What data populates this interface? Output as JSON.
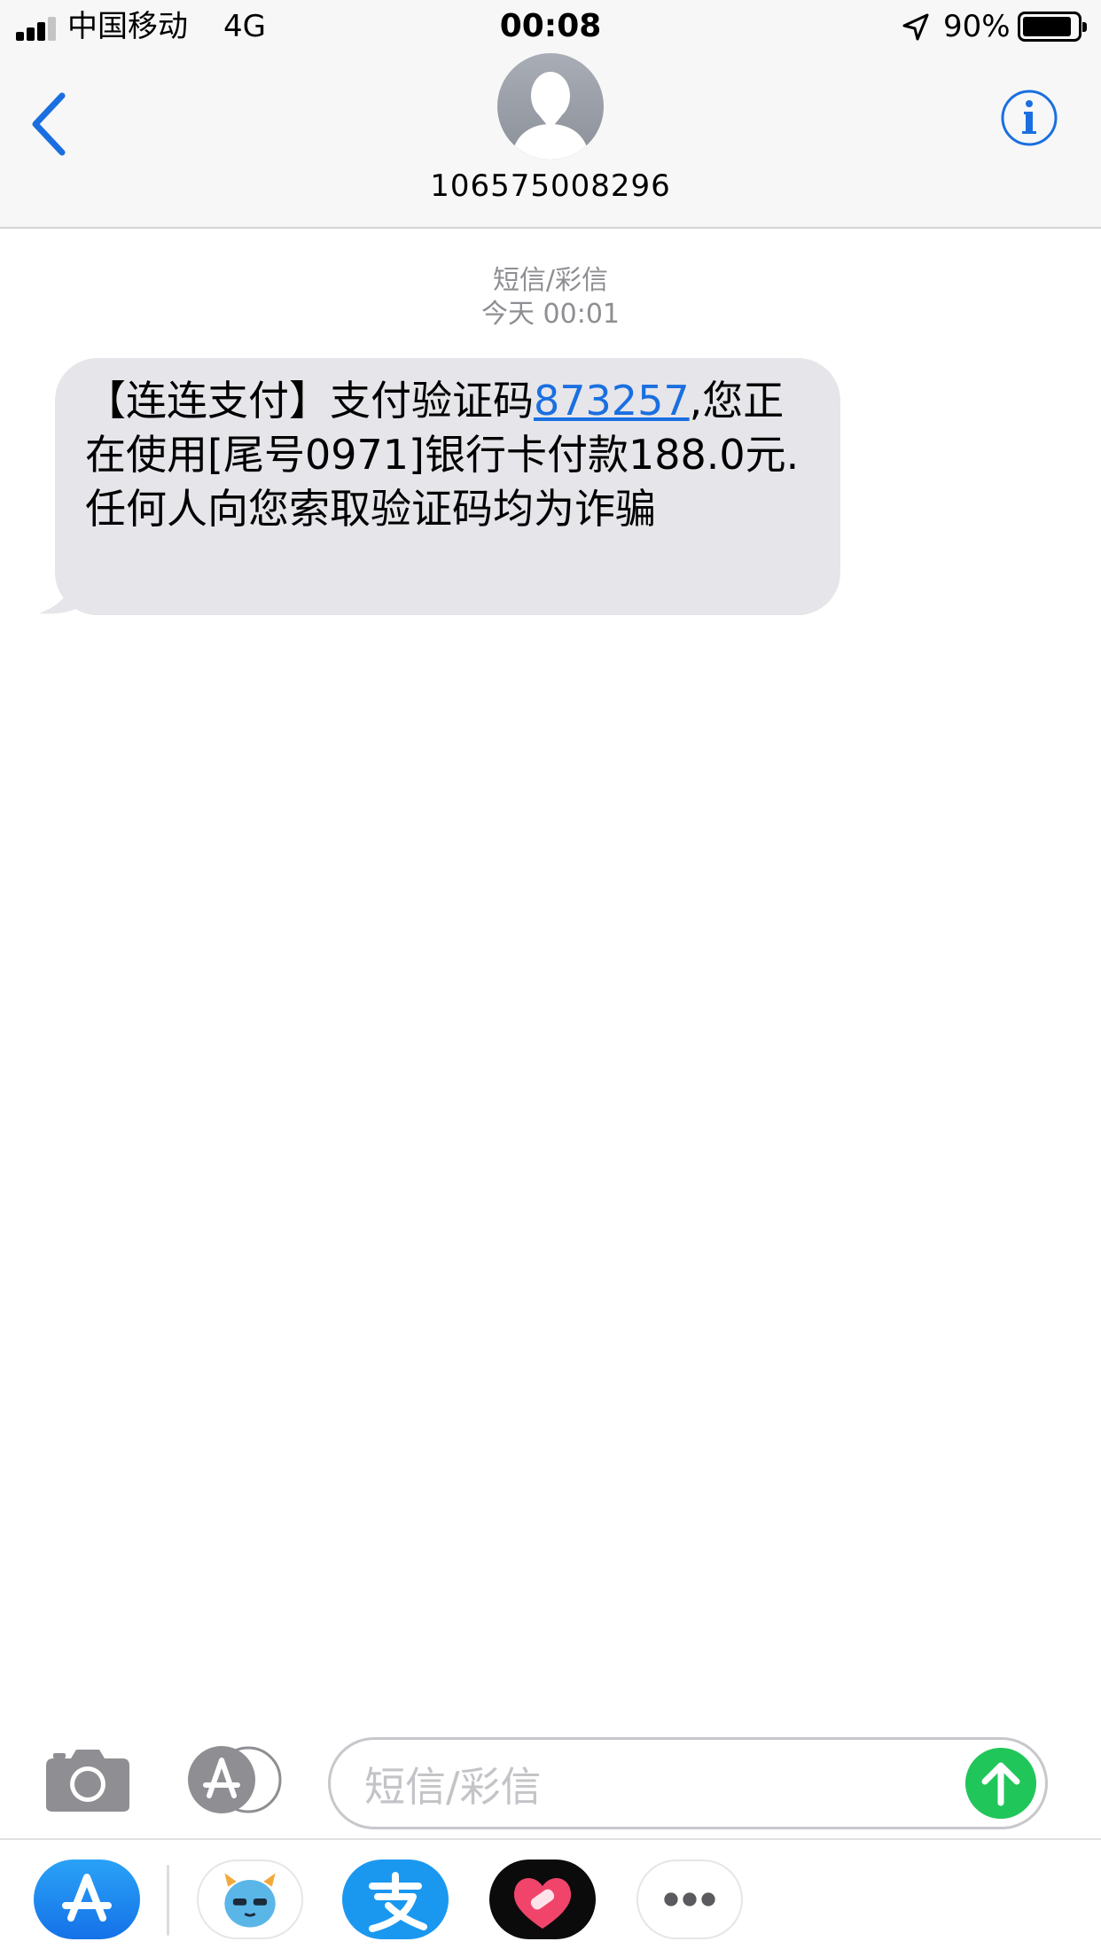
{
  "status_bar": {
    "carrier": "中国移动",
    "network": "4G",
    "time": "00:08",
    "battery_percent": "90%",
    "battery_level": 0.9,
    "icons": [
      "signal-icon",
      "location-arrow-icon",
      "battery-icon"
    ]
  },
  "header": {
    "contact": "106575008296",
    "icons": [
      "back-chevron-icon",
      "contact-avatar-icon",
      "info-icon"
    ],
    "accent_color": "#1a6fe0"
  },
  "conversation": {
    "type_label": "短信/彩信",
    "timestamp": "今天 00:01",
    "message": {
      "prefix": "【连连支付】支付验证码",
      "code": "873257",
      "suffix": ",您正在使用[尾号0971]银行卡付款188.0元.任何人向您索取验证码均为诈骗",
      "bubble_color": "#e5e5ea"
    }
  },
  "compose": {
    "placeholder": "短信/彩信",
    "icons": [
      "camera-icon",
      "app-store-icon",
      "send-arrow-icon"
    ],
    "send_color": "#21c65a"
  },
  "app_drawer": {
    "apps": [
      "app-store-icon",
      "monster-sticker-icon",
      "alipay-icon",
      "heart-bandage-icon",
      "more-dots-icon"
    ]
  }
}
